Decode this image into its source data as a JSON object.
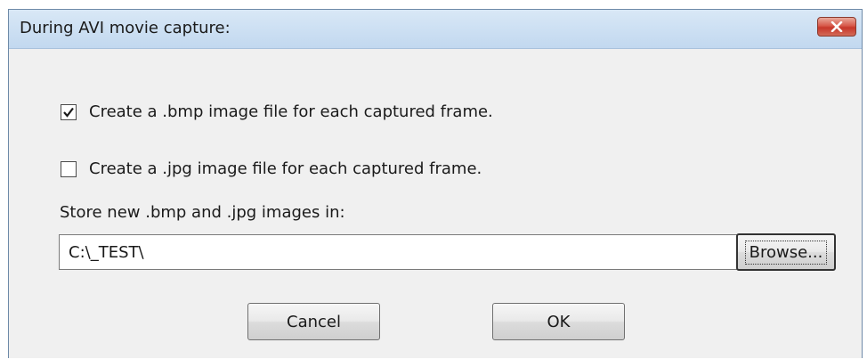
{
  "window": {
    "title": "During AVI movie capture:",
    "close_icon": "close-icon"
  },
  "options": [
    {
      "label": "Create a .bmp image file for each captured frame.",
      "checked": true
    },
    {
      "label": "Create a .jpg image file for each captured frame.",
      "checked": false
    }
  ],
  "store": {
    "label": "Store new .bmp and .jpg images in:",
    "path_value": "C:\\_TEST\\"
  },
  "buttons": {
    "browse_label": "Browse...",
    "cancel_label": "Cancel",
    "ok_label": "OK"
  },
  "colors": {
    "titlebar": "#cde0f3",
    "close_button": "#c7372a",
    "dialog_background": "#f0f0f0"
  }
}
